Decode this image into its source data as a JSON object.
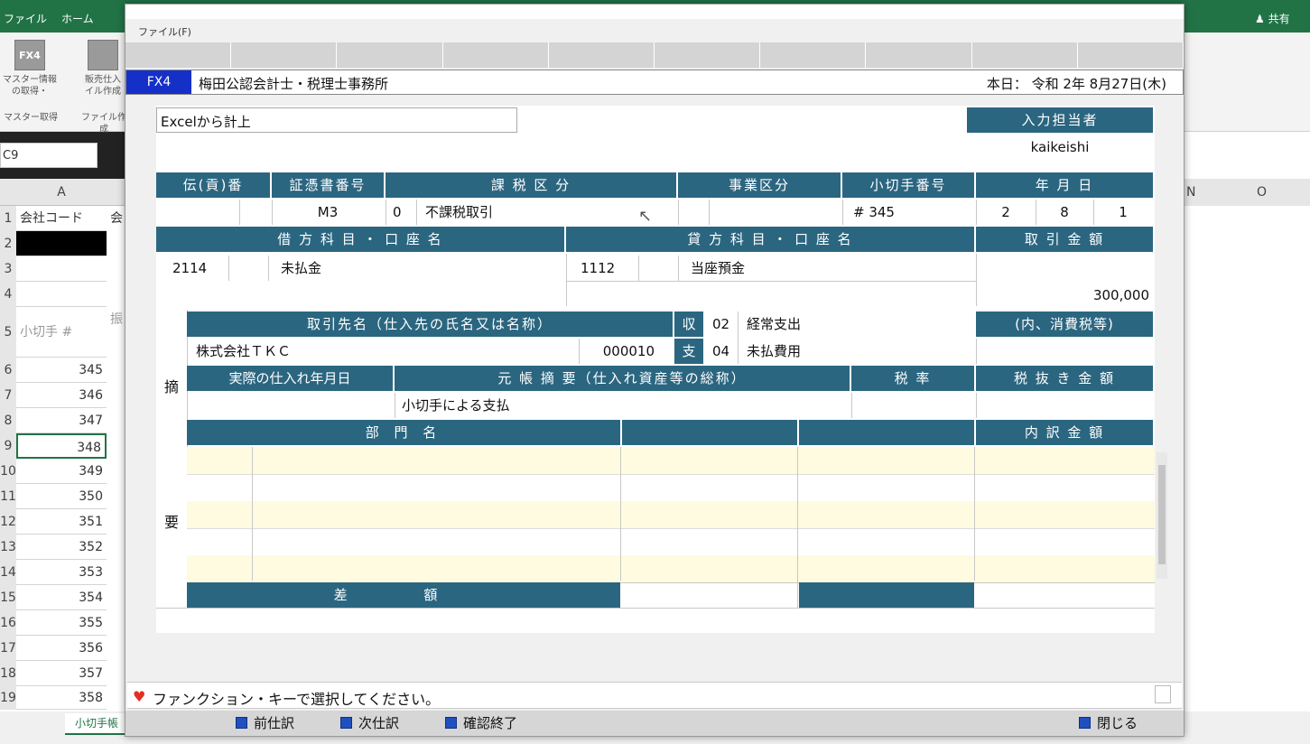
{
  "excel": {
    "ribbon_tabs": [
      "ファイル",
      "ホーム"
    ],
    "share_label": "共有",
    "tools": [
      {
        "icon": "FX4",
        "label": "マスター情報\nの取得・",
        "group": "マスター取得"
      },
      {
        "icon": "",
        "label": "販売仕入\nイル作成",
        "group": "ファイル作成"
      }
    ],
    "namebox": "C9",
    "col_a": "A",
    "col_n": "N",
    "col_o": "O",
    "row1": "会社コード",
    "row1b": "会",
    "row5": "小切手 #",
    "row5b": "振",
    "rows": [
      {
        "n": "1",
        "v": ""
      },
      {
        "n": "2",
        "v": ""
      },
      {
        "n": "3",
        "v": ""
      },
      {
        "n": "4",
        "v": ""
      },
      {
        "n": "5",
        "v": ""
      },
      {
        "n": "6",
        "v": "345"
      },
      {
        "n": "7",
        "v": "346"
      },
      {
        "n": "8",
        "v": "347"
      },
      {
        "n": "9",
        "v": "348"
      },
      {
        "n": "10",
        "v": "349"
      },
      {
        "n": "11",
        "v": "350"
      },
      {
        "n": "12",
        "v": "351"
      },
      {
        "n": "13",
        "v": "352"
      },
      {
        "n": "14",
        "v": "353"
      },
      {
        "n": "15",
        "v": "354"
      },
      {
        "n": "16",
        "v": "355"
      },
      {
        "n": "17",
        "v": "356"
      },
      {
        "n": "18",
        "v": "357"
      },
      {
        "n": "19",
        "v": "358"
      }
    ],
    "sheet_tab": "小切手帳"
  },
  "dialog": {
    "menu_file": "ファイル(F)",
    "badge": "FX4",
    "office_name": "梅田公認会計士・税理士事務所",
    "today": "本日： 令和 2年 8月27日(木)",
    "memo": "Excelから計上",
    "staff_header": "入力担当者",
    "staff_value": "kaikeishi",
    "headers": {
      "denpyo": "伝(貢)番",
      "shohyo": "証憑書番号",
      "kazei": "課 税 区 分",
      "jigyo": "事業区分",
      "kogitte": "小切手番号",
      "ymd": "年 月 日",
      "karikata": "借 方 科 目 ・ 口 座 名",
      "kashikata": "貸 方 科 目 ・ 口 座 名",
      "torihiki": "取 引 金 額",
      "torihikisaki": "取引先名（仕入先の氏名又は名称）",
      "shu": "収",
      "shi": "支",
      "uchi": "(内、消費税等)",
      "jissai": "実際の仕入れ年月日",
      "motocho": "元 帳 摘 要（仕入れ資産等の総称）",
      "zeiritsu": "税 率",
      "zeinuki": "税 抜 き 金 額",
      "bumon": "部 門 名",
      "uchiwake": "内 訳 金 額",
      "sagaku": "差 額"
    },
    "values": {
      "shohyo": "M3",
      "kazei_code": "0",
      "kazei_name": "不課税取引",
      "kogitte": "# 345",
      "year": "2",
      "month": "8",
      "day": "1",
      "debit_code": "2114",
      "debit_name": "未払金",
      "credit_code": "1112",
      "credit_name": "当座預金",
      "amount": "300,000",
      "partner_name": "株式会社ＴＫＣ",
      "partner_code": "000010",
      "shu_code": "02",
      "shu_name": "経常支出",
      "shi_code": "04",
      "shi_name": "未払費用",
      "tekiyo": "小切手による支払"
    },
    "side_teki": "摘",
    "side_yo": "要",
    "message": "ファンクション・キーで選択してください。",
    "fkeys": [
      {
        "label": "前仕訳"
      },
      {
        "label": "次仕訳"
      },
      {
        "label": "確認終了"
      },
      {
        "label": "閉じる"
      }
    ]
  }
}
